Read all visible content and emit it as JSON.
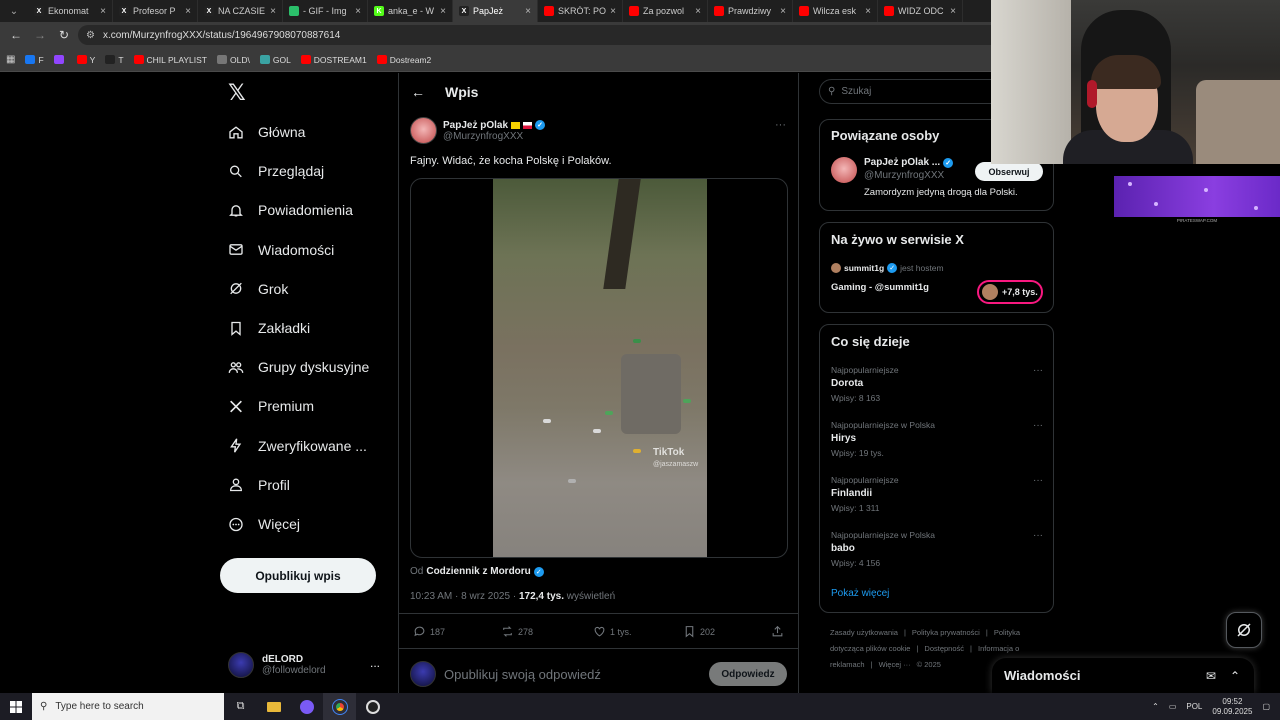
{
  "browser": {
    "tabs": [
      {
        "label": "Ekonomat",
        "icon": "x-icon",
        "active": false
      },
      {
        "label": "Profesor P",
        "icon": "x-icon",
        "active": false
      },
      {
        "label": "NA CZASIE",
        "icon": "x-icon",
        "active": false
      },
      {
        "label": "- GIF - Img",
        "icon": "gif-icon",
        "active": false
      },
      {
        "label": "anka_e - W",
        "icon": "kick-icon",
        "active": false
      },
      {
        "label": "PapJeż",
        "icon": "x-icon",
        "active": true
      },
      {
        "label": "SKRÓT: PO",
        "icon": "youtube-icon",
        "active": false
      },
      {
        "label": "Za pozwol",
        "icon": "youtube-icon",
        "active": false
      },
      {
        "label": "Prawdziwy",
        "icon": "youtube-icon",
        "active": false
      },
      {
        "label": "Wilcza esk",
        "icon": "youtube-icon",
        "active": false
      },
      {
        "label": "WIDZ ODC",
        "icon": "youtube-icon",
        "active": false
      }
    ],
    "url": "x.com/MurzynfrogXXX/status/1964967908070887614",
    "bookmarks": [
      {
        "label": "F",
        "color": "#1877f2"
      },
      {
        "label": "",
        "color": "#9146ff"
      },
      {
        "label": "Y",
        "color": "#ff0000"
      },
      {
        "label": "T",
        "color": "#222222"
      },
      {
        "label": "CHIL PLAYLIST",
        "color": "#ff0000"
      },
      {
        "label": "OLD\\",
        "color": "#777777"
      },
      {
        "label": "GOL",
        "color": "#3aa3a3"
      },
      {
        "label": "DOSTREAM1",
        "color": "#ff0000"
      },
      {
        "label": "Dostream2",
        "color": "#ff0000"
      }
    ]
  },
  "nav": {
    "logo": "𝕏",
    "items": [
      {
        "label": "Główna",
        "icon": "home-icon"
      },
      {
        "label": "Przeglądaj",
        "icon": "search-icon"
      },
      {
        "label": "Powiadomienia",
        "icon": "bell-icon"
      },
      {
        "label": "Wiadomości",
        "icon": "mail-icon"
      },
      {
        "label": "Grok",
        "icon": "grok-icon"
      },
      {
        "label": "Zakładki",
        "icon": "bookmark-icon"
      },
      {
        "label": "Grupy dyskusyjne",
        "icon": "communities-icon"
      },
      {
        "label": "Premium",
        "icon": "x-premium-icon"
      },
      {
        "label": "Zweryfikowane ...",
        "icon": "lightning-icon"
      },
      {
        "label": "Profil",
        "icon": "person-icon"
      },
      {
        "label": "Więcej",
        "icon": "more-circle-icon"
      }
    ],
    "post_button": "Opublikuj wpis",
    "account": {
      "name": "dELORD",
      "handle": "@followdelord",
      "more": "..."
    }
  },
  "post": {
    "header_title": "Wpis",
    "author_name": "PapJeż pOlak",
    "author_handle": "@MurzynfrogXXX",
    "text": "Fajny. Widać, że kocha Polskę i Polaków.",
    "video_watermark": "TikTok",
    "video_watermark_handle": "@jaszamaszw",
    "via_prefix": "Od",
    "via_source": "Codziennik z Mordoru",
    "timestamp": "10:23 AM · 8 wrz 2025 ·",
    "views": "172,4 tys.",
    "views_label": "wyświetleń",
    "stats": {
      "replies": "187",
      "reposts": "278",
      "likes": "1 tys.",
      "bookmarks": "202"
    },
    "reply_placeholder": "Opublikuj swoją odpowiedź",
    "reply_button": "Odpowiedz"
  },
  "sidebar": {
    "search_placeholder": "Szukaj",
    "related": {
      "title": "Powiązane osoby",
      "name": "PapJeż pOlak ...",
      "handle": "@MurzynfrogXXX",
      "bio": "Zamordyzm jedyną drogą dla Polski.",
      "follow": "Obserwuj"
    },
    "live": {
      "title": "Na żywo w serwisie X",
      "host": "summit1g",
      "host_suffix": "jest hostem",
      "space": "Gaming - @summit1g",
      "listeners": "+7,8 tys."
    },
    "trends": {
      "title": "Co się dzieje",
      "items": [
        {
          "context": "Najpopularniejsze",
          "name": "Dorota",
          "count": "Wpisy: 8 163"
        },
        {
          "context": "Najpopularniejsze w Polska",
          "name": "Hirys",
          "count": "Wpisy: 19 tys."
        },
        {
          "context": "Najpopularniejsze",
          "name": "Finlandii",
          "count": "Wpisy: 1 311"
        },
        {
          "context": "Najpopularniejsze w Polska",
          "name": "babo",
          "count": "Wpisy: 4 156"
        }
      ],
      "show_more": "Pokaż więcej"
    },
    "footer": [
      "Zasady użytkowania",
      "|",
      "Polityka prywatności",
      "|",
      "Polityka dotycząca plików cookie",
      "|",
      "Dostępność",
      "|",
      "Informacja o reklamach",
      "|",
      "Więcej ···",
      "© 2025"
    ]
  },
  "drawer": {
    "title": "Wiadomości"
  },
  "overlay": {
    "banner_caption": "PIRATESWAP.COM"
  },
  "taskbar": {
    "search_placeholder": "Type here to search",
    "language": "POL",
    "time": "09:52",
    "date": "09.09.2025"
  },
  "colors": {
    "accent": "#1d9bf0",
    "live": "#f91880",
    "youtube": "#ff0000"
  }
}
